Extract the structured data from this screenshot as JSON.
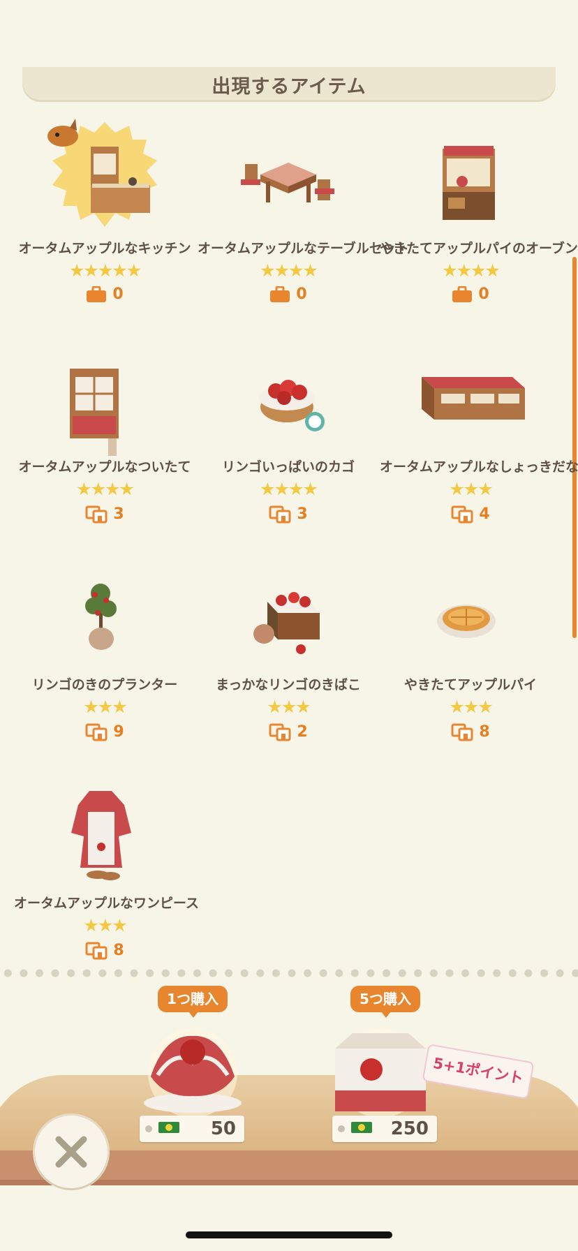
{
  "header": {
    "title": "出現するアイテム"
  },
  "items": [
    {
      "name": "オータムアップルなキッチン",
      "stars": "★★★★★",
      "count": "0",
      "count_icon": "bag-icon"
    },
    {
      "name": "オータムアップルなテーブルセット",
      "stars": "★★★★",
      "count": "0",
      "count_icon": "bag-icon"
    },
    {
      "name": "やきたてアップルパイのオーブン",
      "stars": "★★★★",
      "count": "0",
      "count_icon": "bag-icon"
    },
    {
      "name": "オータムアップルなついたて",
      "stars": "★★★★",
      "count": "3",
      "count_icon": "multi-bag-icon"
    },
    {
      "name": "リンゴいっぱいのカゴ",
      "stars": "★★★★",
      "count": "3",
      "count_icon": "multi-bag-icon"
    },
    {
      "name": "オータムアップルなしょっきだな",
      "stars": "★★★",
      "count": "4",
      "count_icon": "multi-bag-icon"
    },
    {
      "name": "リンゴのきのプランター",
      "stars": "★★★",
      "count": "9",
      "count_icon": "multi-bag-icon"
    },
    {
      "name": "まっかなリンゴのきばこ",
      "stars": "★★★",
      "count": "2",
      "count_icon": "multi-bag-icon"
    },
    {
      "name": "やきたてアップルパイ",
      "stars": "★★★",
      "count": "8",
      "count_icon": "multi-bag-icon"
    },
    {
      "name": "オータムアップルなワンピース",
      "stars": "★★★",
      "count": "8",
      "count_icon": "multi-bag-icon"
    }
  ],
  "purchase": {
    "single": {
      "label": "1つ購入",
      "price": "50"
    },
    "five": {
      "label": "5つ購入",
      "price": "250",
      "bonus": "5+1ポイント"
    }
  },
  "colors": {
    "accent": "#e8862f",
    "star": "#f3c842",
    "background": "#f7f4e8",
    "bonus": "#d6426a"
  }
}
